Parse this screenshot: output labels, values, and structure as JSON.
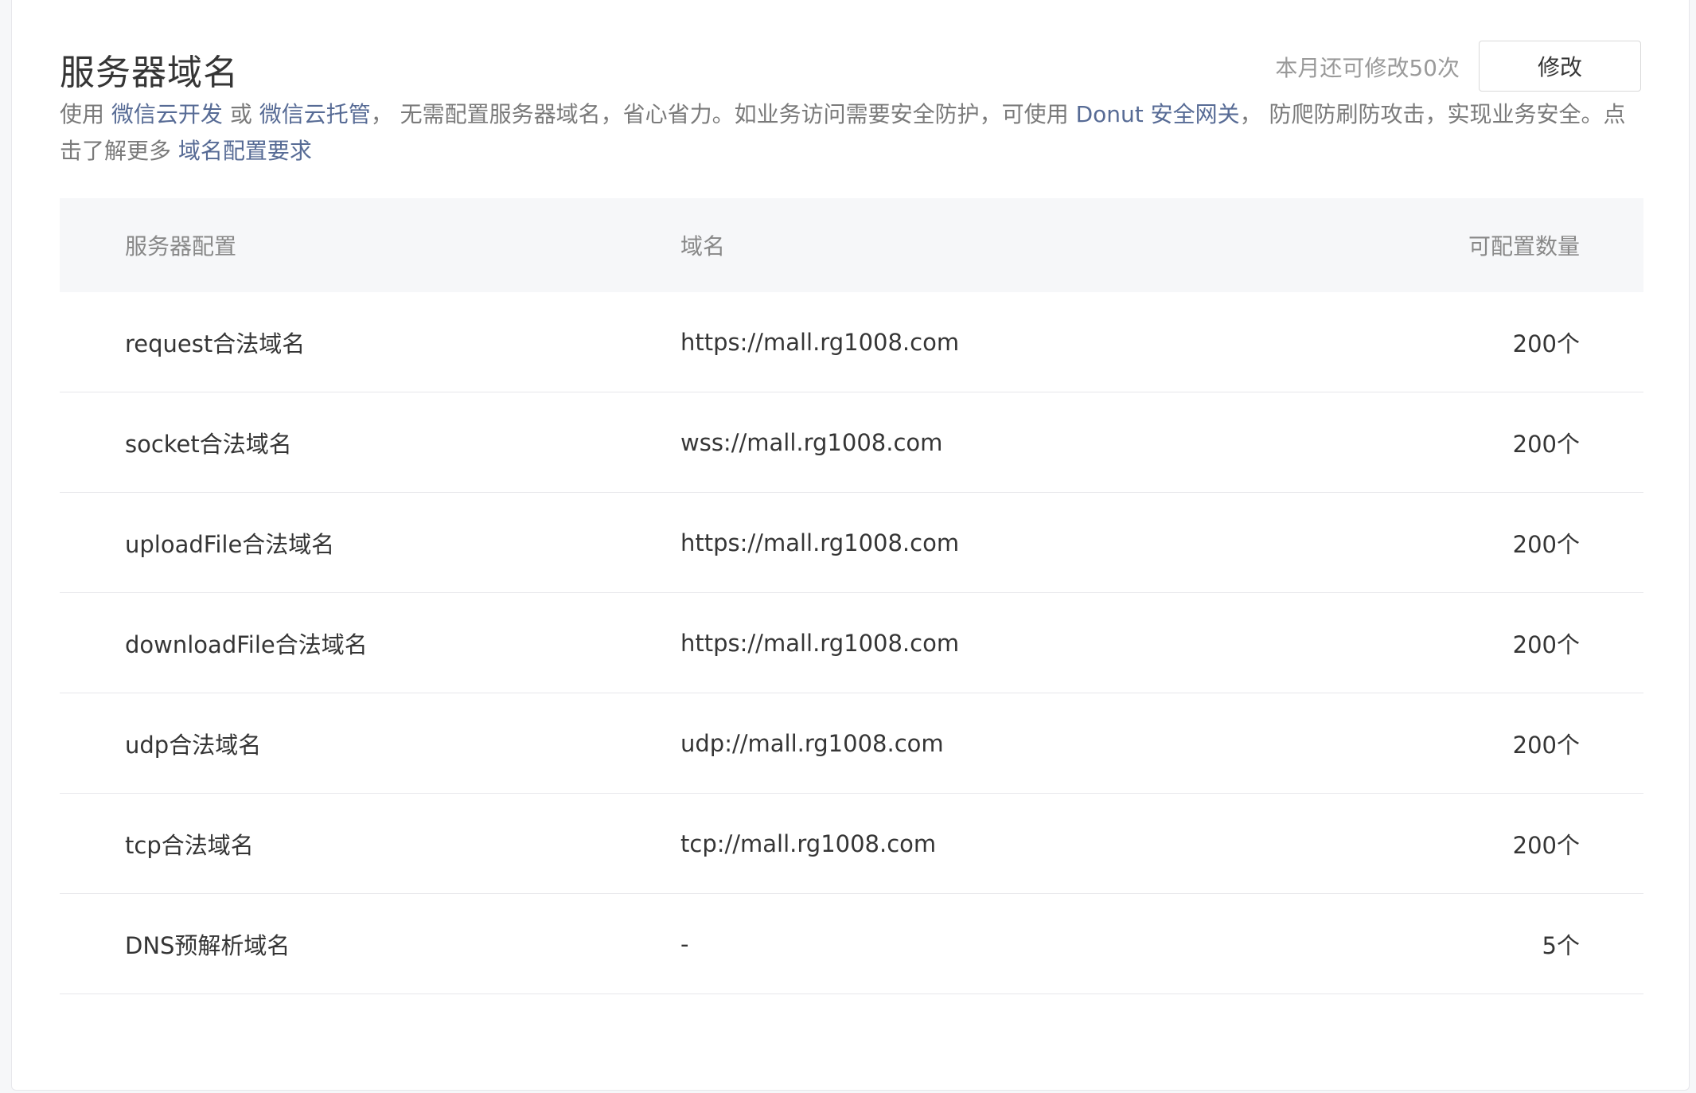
{
  "header": {
    "title": "服务器域名",
    "quota_text": "本月还可修改50次",
    "modify_label": "修改"
  },
  "description": {
    "t1": "使用 ",
    "link1": "微信云开发",
    "t2": " 或 ",
    "link2": "微信云托管",
    "t3": "， 无需配置服务器域名，省心省力。如业务访问需要安全防护，可使用 ",
    "link3": "Donut 安全网关",
    "t4": "， 防爬防刷防攻击，实现业务安全。点击了解更多 ",
    "link4": "域名配置要求"
  },
  "table": {
    "headers": [
      "服务器配置",
      "域名",
      "可配置数量"
    ],
    "rows": [
      {
        "config": "request合法域名",
        "domain": "https://mall.rg1008.com",
        "count": "200个"
      },
      {
        "config": "socket合法域名",
        "domain": "wss://mall.rg1008.com",
        "count": "200个"
      },
      {
        "config": "uploadFile合法域名",
        "domain": "https://mall.rg1008.com",
        "count": "200个"
      },
      {
        "config": "downloadFile合法域名",
        "domain": "https://mall.rg1008.com",
        "count": "200个"
      },
      {
        "config": "udp合法域名",
        "domain": "udp://mall.rg1008.com",
        "count": "200个"
      },
      {
        "config": "tcp合法域名",
        "domain": "tcp://mall.rg1008.com",
        "count": "200个"
      },
      {
        "config": "DNS预解析域名",
        "domain": "-",
        "count": "5个"
      }
    ]
  },
  "colors": {
    "link": "#576b95",
    "header_bg": "#f6f7f9",
    "border": "#e7e7eb"
  }
}
